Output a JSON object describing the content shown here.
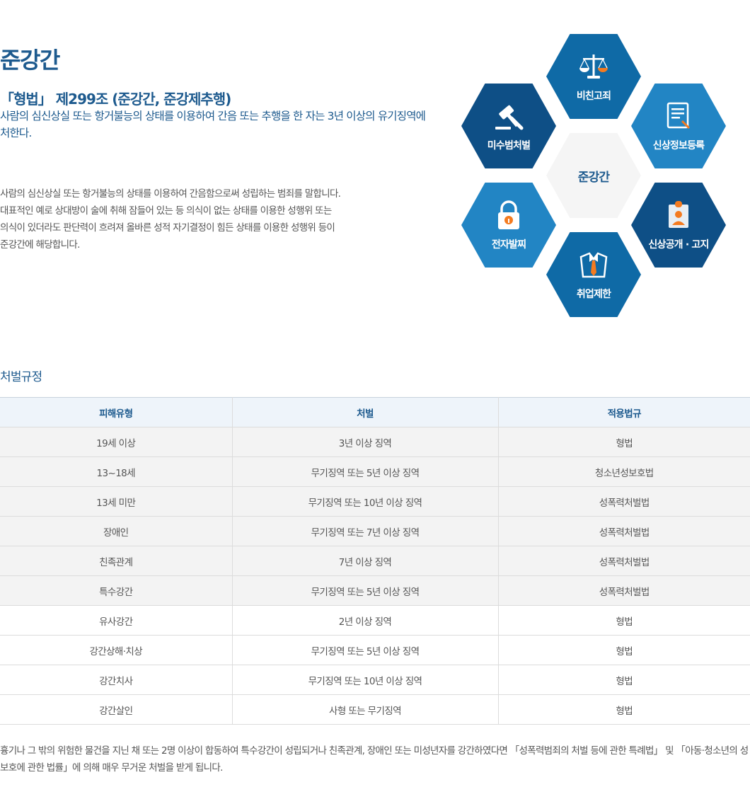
{
  "header": {
    "title": "준강간",
    "law_title": "「형법」 제299조 (준강간, 준강제추행)",
    "law_text": "사람의 심신상실 또는 항거불능의 상태를 이용하여 간음 또는 추행을 한 자는 3년 이상의 유기징역에 처한다."
  },
  "description": "사람의 심신상실 또는 항거불능의 상태를 이용하여 간음함으로써 성립하는 범죄를 말합니다.\n대표적인 예로 상대방이 술에 취해 잠들어 있는 등 의식이 없는 상태를 이용한 성행위 또는\n의식이 있더라도 판단력이 흐려져 올바른 성적 자기결정이 힘든 상태를 이용한 성행위 등이\n준강간에 해당합니다.",
  "diagram": {
    "center": "준강간",
    "items": [
      {
        "label": "비친고죄",
        "icon": "scales-icon",
        "color": "#0f6aa6"
      },
      {
        "label": "신상정보등록",
        "icon": "document-icon",
        "color": "#2285c4"
      },
      {
        "label": "신상공개 · 고지",
        "icon": "id-card-icon",
        "color": "#0e4f86"
      },
      {
        "label": "취업제한",
        "icon": "suit-icon",
        "color": "#0f6aa6"
      },
      {
        "label": "전자발찌",
        "icon": "lock-icon",
        "color": "#2285c4"
      },
      {
        "label": "미수범처벌",
        "icon": "gavel-icon",
        "color": "#0e4f86"
      }
    ]
  },
  "penalty": {
    "title": "처벌규정",
    "headers": [
      "피해유형",
      "처벌",
      "적용법규"
    ],
    "rows": [
      [
        "19세 이상",
        "3년 이상 징역",
        "형법"
      ],
      [
        "13~18세",
        "무기징역 또는 5년 이상 징역",
        "청소년성보호법"
      ],
      [
        "13세 미만",
        "무기징역 또는 10년 이상 징역",
        "성폭력처벌법"
      ],
      [
        "장애인",
        "무기징역 또는 7년 이상 징역",
        "성폭력처벌법"
      ],
      [
        "친족관계",
        "7년 이상 징역",
        "성폭력처벌법"
      ],
      [
        "특수강간",
        "무기징역 또는 5년 이상 징역",
        "성폭력처벌법"
      ],
      [
        "유사강간",
        "2년 이상 징역",
        "형법"
      ],
      [
        "강간상해·치상",
        "무기징역 또는 5년 이상 징역",
        "형법"
      ],
      [
        "강간치사",
        "무기징역 또는 10년 이상 징역",
        "형법"
      ],
      [
        "강간살인",
        "사형 또는 무기징역",
        "형법"
      ]
    ]
  },
  "note": "흉기나 그 밖의 위험한 물건을 지닌 채 또는 2명 이상이 합동하여 특수강간이 성립되거나 친족관계, 장애인 또는 미성년자를 강간하였다면 「성폭력범죄의 처벌 등에 관한 특례법」 및 「아동·청소년의 성 보호에 관한 법률」에 의해 매우 무거운 처벌을 받게 됩니다.",
  "colors": {
    "accent": "#1d5a8e",
    "highlight": "#f47b20"
  }
}
